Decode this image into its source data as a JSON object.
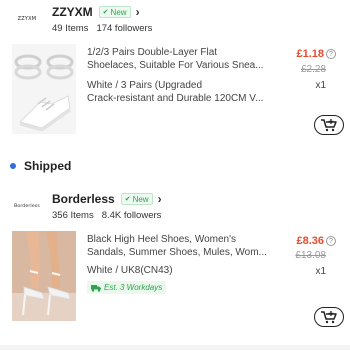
{
  "stores": [
    {
      "logo_text": "ZZYXM",
      "name": "ZZYXM",
      "badge": "New",
      "items_count": "49 Items",
      "followers": "174 followers"
    },
    {
      "logo_text": "Borderless",
      "name": "Borderless",
      "badge": "New",
      "items_count": "356 Items",
      "followers": "8.4K followers"
    }
  ],
  "items": [
    {
      "title_line1": "1/2/3 Pairs Double-Layer Flat",
      "title_line2": "Shoelaces, Suitable For Various Snea...",
      "variant_line1": "White / 3 Pairs (Upgraded",
      "variant_line2": "Crack-resistant and Durable 120CM V...",
      "price": "£1.18",
      "original_price": "£2.28",
      "quantity": "x1"
    },
    {
      "title_line1": "Black High Heel Shoes, Women's",
      "title_line2": "Sandals, Summer Shoes, Mules, Wom...",
      "variant": "White / UK8(CN43)",
      "price": "£8.36",
      "original_price": "£13.08",
      "quantity": "x1",
      "delivery": "Est. 3 Workdays"
    }
  ],
  "section": {
    "shipped_label": "Shipped"
  },
  "colors": {
    "price": "#e84a2f",
    "new_badge": "#2ea44f",
    "status_dot": "#2f6fd6"
  },
  "icons": [
    "check-icon",
    "chevron-right-icon",
    "help-icon",
    "add-to-cart-icon",
    "truck-icon"
  ]
}
